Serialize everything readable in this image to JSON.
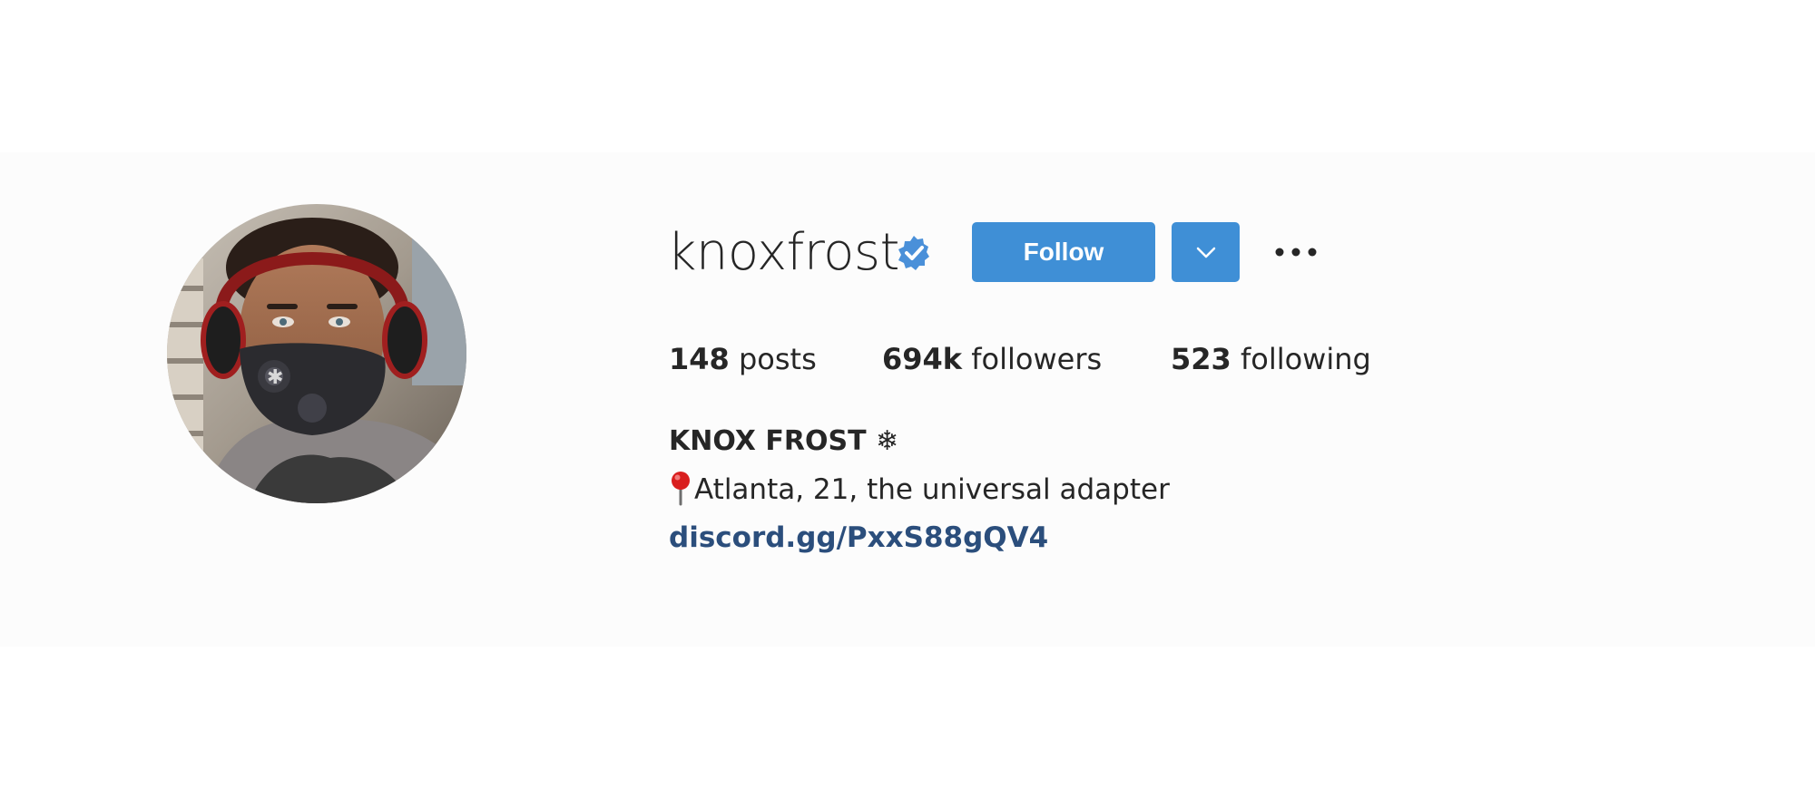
{
  "profile": {
    "username": "knoxfrost",
    "full_name": "KNOX FROST ❄",
    "bio": "Atlanta, 21, the universal adapter",
    "link": "discord.gg/PxxS88gQV4",
    "verified": true
  },
  "actions": {
    "follow_label": "Follow",
    "dropdown_icon": "chevron-down-icon",
    "more_icon": "more-options-icon"
  },
  "stats": {
    "posts_count": "148",
    "posts_label": " posts",
    "followers_count": "694k",
    "followers_label": " followers",
    "following_count": "523",
    "following_label": " following"
  },
  "colors": {
    "button_blue": "#3f8fd6",
    "link_blue": "#2b4e7c",
    "verified_blue": "#4a90d9",
    "text": "#262626"
  }
}
